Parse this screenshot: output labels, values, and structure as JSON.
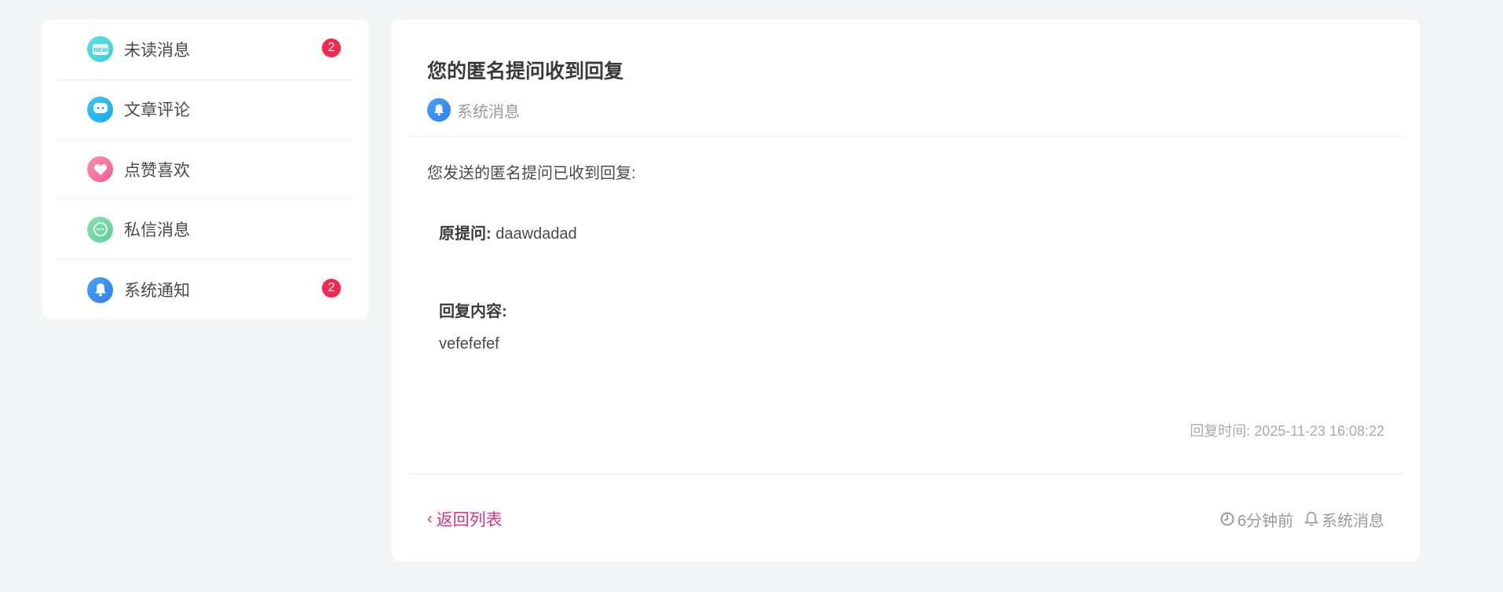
{
  "sidebar": {
    "items": [
      {
        "label": "未读消息",
        "icon": "new-icon",
        "badge": "2"
      },
      {
        "label": "文章评论",
        "icon": "comment-icon",
        "badge": ""
      },
      {
        "label": "点赞喜欢",
        "icon": "heart-icon",
        "badge": ""
      },
      {
        "label": "私信消息",
        "icon": "chat-icon",
        "badge": ""
      },
      {
        "label": "系统通知",
        "icon": "bell-icon",
        "badge": "2"
      }
    ]
  },
  "message": {
    "title": "您的匿名提问收到回复",
    "category": "系统消息",
    "intro": "您发送的匿名提问已收到回复:",
    "original_question_label": "原提问:",
    "original_question": "daawdadad",
    "reply_label": "回复内容:",
    "reply_content": "vefefefef",
    "reply_time": "回复时间: 2025-11-23 16:08:22"
  },
  "footer": {
    "back_label": "返回列表",
    "time_ago": "6分钟前",
    "category": "系统消息"
  },
  "colors": {
    "accent": "#e0318b",
    "badge": "#f5284e",
    "bell": "#2d7fec"
  }
}
